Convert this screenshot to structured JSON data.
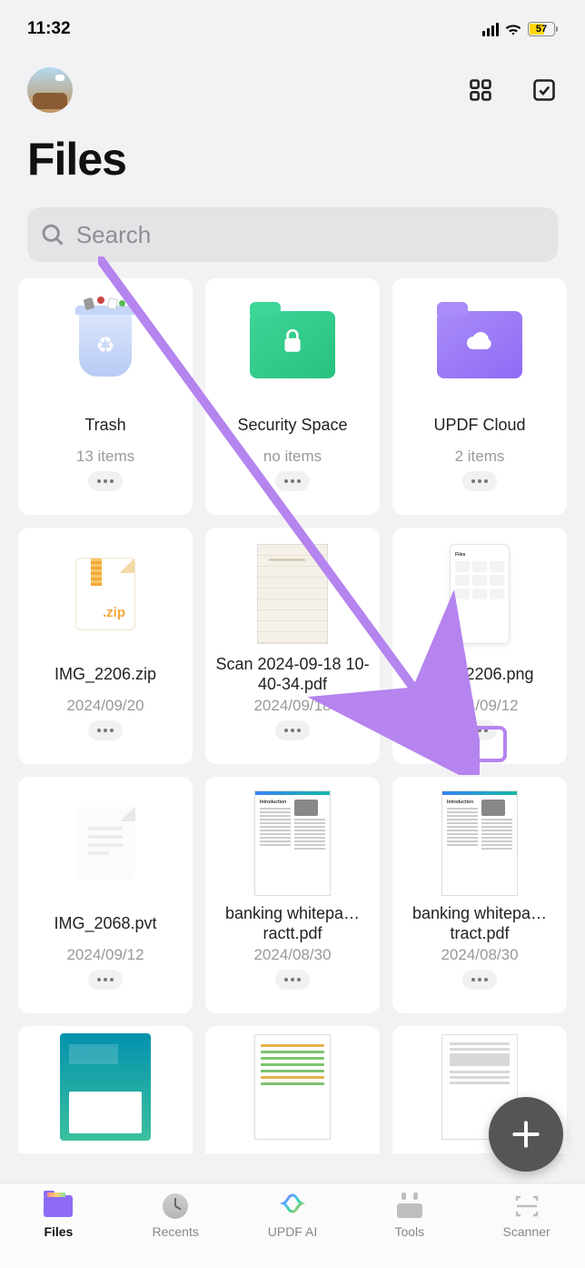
{
  "status": {
    "time": "11:32",
    "battery": "57"
  },
  "header": {
    "title": "Files"
  },
  "search": {
    "placeholder": "Search"
  },
  "tiles": [
    {
      "name": "Trash",
      "meta": "13 items"
    },
    {
      "name": "Security Space",
      "meta": "no items"
    },
    {
      "name": "UPDF Cloud",
      "meta": "2 items"
    },
    {
      "name": "IMG_2206.zip",
      "meta": "2024/09/20"
    },
    {
      "name": "Scan 2024-09-18 10-40-34.pdf",
      "meta": "2024/09/18"
    },
    {
      "name": "IMG_2206.png",
      "meta": "2024/09/12"
    },
    {
      "name": "IMG_2068.pvt",
      "meta": "2024/09/12"
    },
    {
      "name": "banking whitepa…ractt.pdf",
      "meta": "2024/08/30"
    },
    {
      "name": "banking whitepa…tract.pdf",
      "meta": "2024/08/30"
    }
  ],
  "nav": {
    "files": "Files",
    "recents": "Recents",
    "ai": "UPDF AI",
    "tools": "Tools",
    "scanner": "Scanner"
  }
}
